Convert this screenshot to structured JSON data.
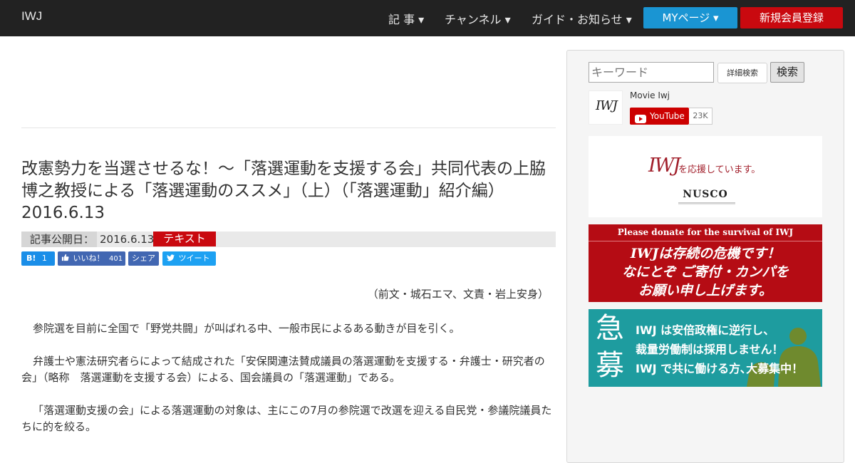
{
  "nav": {
    "brand": "IWJ",
    "articles": "記 事 ▾",
    "channel": "チャンネル ▾",
    "guide": "ガイド・お知らせ ▾",
    "mypage": "MYページ ▾",
    "register": "新規会員登録"
  },
  "article": {
    "title": "改憲勢力を当選させるな！～「落選運動を支援する会」共同代表の上脇博之教授による「落選運動のススメ」（上）（「落選運動」紹介編） 2016.6.13",
    "published_label": "記事公開日：",
    "published_date": "2016.6.13",
    "tag": "テキスト",
    "credit": "（前文・城石エマ、文責・岩上安身）",
    "paragraphs": [
      "参院選を目前に全国で「野党共闘」が叫ばれる中、一般市民によるある動きが目を引く。",
      "弁護士や憲法研究者らによって結成された「安保関連法賛成議員の落選運動を支援する・弁護士・研究者の会」（略称　落選運動を支援する会）による、国会議員の「落選運動」である。",
      "「落選運動支援の会」による落選運動の対象は、主にこの7月の参院選で改選を迎える自民党・参議院議員たちに的を絞る。"
    ]
  },
  "share": {
    "hatena_label": "B!",
    "hatena_count": "1",
    "like_label": "いいね！",
    "like_count": "401",
    "share_label": "シェア",
    "tweet_label": "ツイート"
  },
  "sidebar": {
    "search_placeholder": "キーワード",
    "advanced_search": "詳細検索",
    "search_button": "検索",
    "channel_name": "Movie Iwj",
    "youtube_label": "YouTube",
    "subscriber_count": "23K",
    "channel_logo_text": "IWJ",
    "banner1": {
      "logo": "IWJ",
      "text": "を応援しています。",
      "sponsor": "NUSCO"
    },
    "banner2": {
      "heading": "Please donate for the survival of IWJ",
      "lines": [
        "IWJは存続の危機です！",
        "なにとぞ ご寄付・カンパを",
        "お願い申し上げます。"
      ]
    },
    "banner3": {
      "big1": "急",
      "big2": "募",
      "lines": [
        "IWJ は安倍政権に逆行し、",
        "裁量労働制は採用しません！",
        "IWJ で共に働ける方､大募集中！"
      ]
    }
  },
  "colors": {
    "nav_bg": "#222222",
    "mypage_blue": "#1a95d3",
    "register_red": "#c9090f",
    "tag_red": "#c9090f",
    "hatena_blue": "#1a8ee8",
    "facebook_blue": "#4267b2",
    "twitter_blue": "#1da1f2",
    "youtube_red": "#cc0000",
    "banner_red": "#b50c14",
    "banner_teal": "#1e9c9f"
  }
}
